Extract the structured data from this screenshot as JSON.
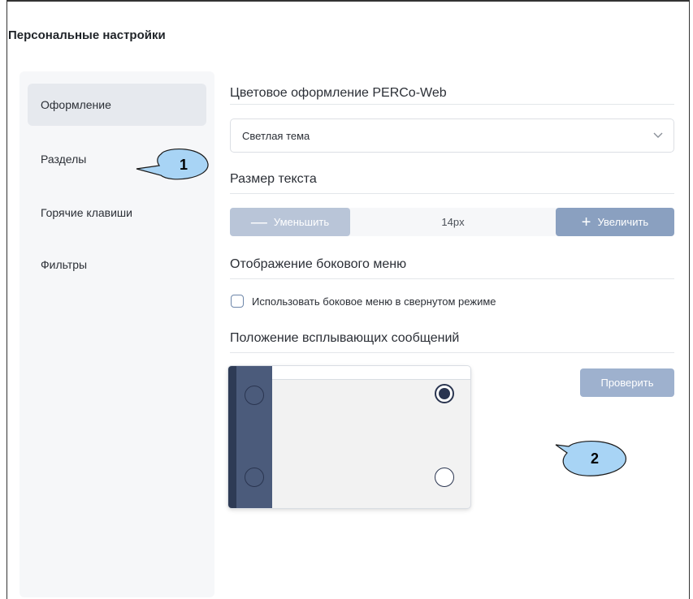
{
  "page": {
    "title": "Персональные настройки"
  },
  "sidebar": {
    "items": [
      {
        "label": "Оформление",
        "active": true
      },
      {
        "label": "Разделы",
        "active": false
      },
      {
        "label": "Горячие клавиши",
        "active": false
      },
      {
        "label": "Фильтры",
        "active": false
      }
    ]
  },
  "theme": {
    "section_label": "Цветовое оформление PERCo-Web",
    "selected": "Светлая тема"
  },
  "text_size": {
    "section_label": "Размер текста",
    "decrease_label": "Уменьшить",
    "increase_label": "Увеличить",
    "value": "14px"
  },
  "side_menu": {
    "section_label": "Отображение бокового меню",
    "checkbox_label": "Использовать боковое меню в свернутом режиме",
    "checked": false
  },
  "notifications": {
    "section_label": "Положение всплывающих сообщений",
    "check_label": "Проверить",
    "selected_position": "top-right"
  },
  "callouts": [
    "1",
    "2"
  ],
  "colors": {
    "accent": "#8aa0c0",
    "accent_light": "#b9c5d8",
    "sidebar_dark": "#2e3b55",
    "callout_fill": "#a8d4f5"
  },
  "icons": {
    "dropdown": "chevron-down-icon",
    "decrease": "minus-icon",
    "increase": "plus-icon"
  }
}
